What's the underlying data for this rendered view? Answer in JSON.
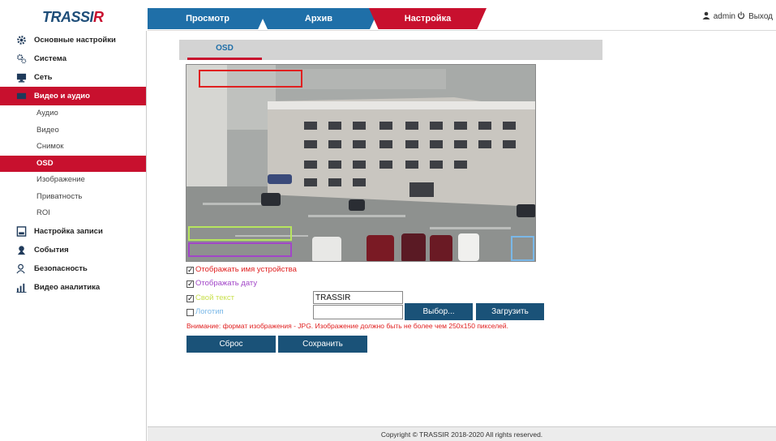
{
  "header": {
    "logo_prefix": "TRASSI",
    "logo_accent": "R",
    "tabs": [
      "Просмотр",
      "Архив",
      "Настройка"
    ],
    "active_tab": "Настройка",
    "user": "admin",
    "logout": "Выход"
  },
  "sidebar": {
    "items": [
      {
        "label": "Основные настройки",
        "icon": "gear-icon"
      },
      {
        "label": "Система",
        "icon": "system-gears-icon"
      },
      {
        "label": "Сеть",
        "icon": "network-icon"
      },
      {
        "label": "Видео и аудио",
        "icon": "video-icon"
      },
      {
        "label": "Настройка записи",
        "icon": "record-settings-icon"
      },
      {
        "label": "События",
        "icon": "events-icon"
      },
      {
        "label": "Безопасность",
        "icon": "security-user-icon"
      },
      {
        "label": "Видео аналитика",
        "icon": "analytics-chart-icon"
      }
    ],
    "subitems": [
      "Аудио",
      "Видео",
      "Снимок",
      "OSD",
      "Изображение",
      "Приватность",
      "ROI"
    ],
    "active_subitem": "OSD"
  },
  "main": {
    "section_tab": "OSD",
    "options": {
      "show_device_name": {
        "label": "Отображать имя устройства",
        "checked": true
      },
      "show_date": {
        "label": "Отображать дату",
        "checked": true
      },
      "own_text": {
        "label": "Свой текст",
        "checked": true,
        "value": "TRASSIR"
      },
      "logo": {
        "label": "Логотип",
        "checked": false
      }
    },
    "buttons": {
      "choose": "Выбор...",
      "upload": "Загрузить",
      "reset": "Сброс",
      "save": "Сохранить"
    },
    "warning": "Внимание: формат изображения - JPG. Изображение должно быть не более чем 250x150 пикселей."
  },
  "footer": {
    "copyright": "Copyright © TRASSIR 2018-2020 All rights reserved."
  },
  "colors": {
    "brand_red": "#c8102e",
    "brand_blue": "#1f6fa8",
    "button_blue": "#1a5278",
    "osd_device": "#e02020",
    "osd_date": "#b7e55e",
    "osd_text": "#a246c8",
    "osd_logo": "#7ab8e8"
  }
}
